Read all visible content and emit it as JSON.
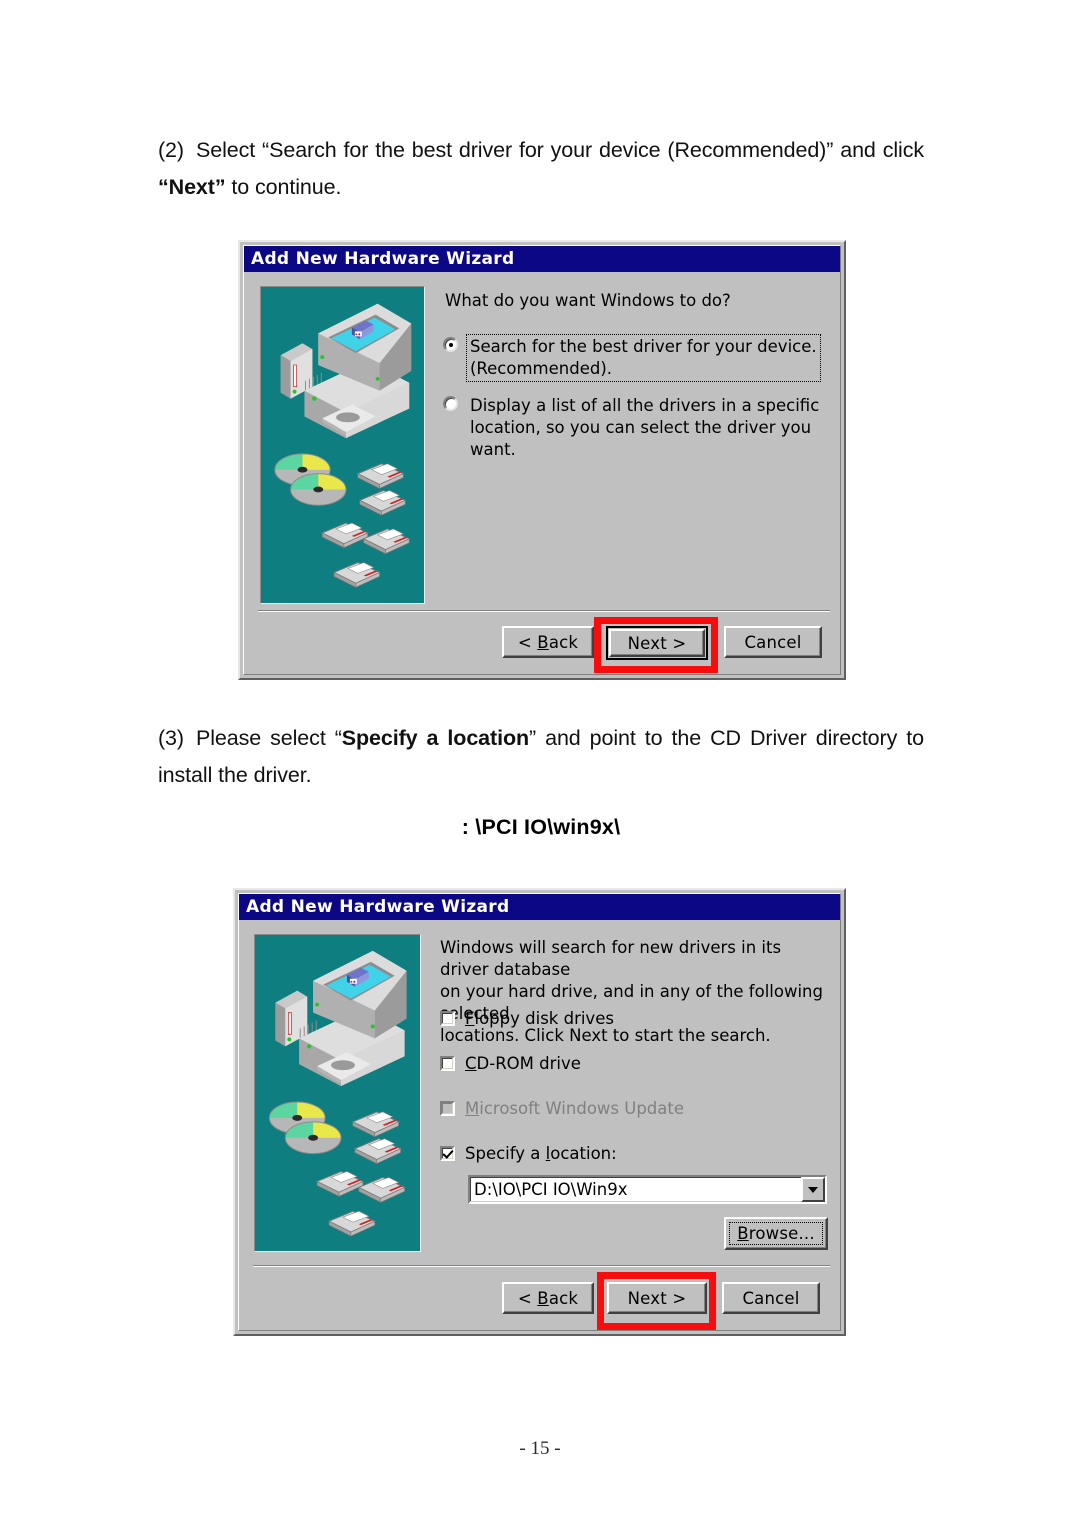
{
  "document": {
    "page_number": "- 15 -",
    "step2": {
      "number": "(2)",
      "text_before": "Select “Search for the best driver for your device (Recommended)” and click ",
      "bold": "“Next”",
      "text_after": " to continue."
    },
    "step3": {
      "number": "(3)",
      "text_before": "Please select “",
      "bold": "Specify a location",
      "text_after": "” and point to the CD Driver directory to install the driver."
    },
    "path_note": ": \\PCI IO\\win9x\\"
  },
  "dialog1": {
    "title": "Add New Hardware Wizard",
    "prompt": "What do you want Windows to do?",
    "options": [
      {
        "id": "search-best-driver",
        "line1": "Search for the best driver for your device.",
        "line2": "(Recommended).",
        "selected": true,
        "focused": true
      },
      {
        "id": "display-list-drivers",
        "line1": "Display a list of all the drivers in a specific",
        "line2": "location, so you can select the driver you want.",
        "selected": false,
        "focused": false
      }
    ],
    "buttons": {
      "back": "< Back",
      "back_mnemonic": "B",
      "next": "Next >",
      "cancel": "Cancel"
    },
    "highlight": {
      "target": "next",
      "color": "#f70d0d"
    }
  },
  "dialog2": {
    "title": "Add New Hardware Wizard",
    "prompt_lines": [
      "Windows will search for new drivers in its driver database",
      "on your hard drive, and in any of the following selected",
      "locations. Click Next to start the search."
    ],
    "checkboxes": [
      {
        "id": "floppy-disk-drives",
        "mnemonic": "F",
        "rest": "loppy disk drives",
        "checked": false,
        "disabled": false
      },
      {
        "id": "cd-rom-drive",
        "mnemonic": "C",
        "rest": "D-ROM drive",
        "checked": false,
        "disabled": false
      },
      {
        "id": "microsoft-windows-update",
        "mnemonic": "M",
        "rest": "icrosoft Windows Update",
        "checked": false,
        "disabled": true
      },
      {
        "id": "specify-a-location",
        "prefix": "Specify a ",
        "mnemonic": "l",
        "rest": "ocation:",
        "checked": true,
        "disabled": false
      }
    ],
    "location_combo": {
      "value": "D:\\IO\\PCI IO\\Win9x",
      "arrow_icon": "chevron-down-icon"
    },
    "browse_button": {
      "mnemonic": "B",
      "prefix": "B",
      "label": "Browse..."
    },
    "buttons": {
      "back": "< Back",
      "back_mnemonic": "B",
      "next": "Next >",
      "cancel": "Cancel"
    },
    "highlight": {
      "target": "next",
      "color": "#f70d0d"
    }
  },
  "illustration": {
    "name": "computer-with-cds-and-floppies-illustration",
    "background": "#0e7e80",
    "elements": [
      "monitor",
      "tower",
      "cd-tray",
      "compact-discs",
      "floppy-disks"
    ]
  },
  "theme": {
    "dialog_face": "#c0c0c0",
    "title_bar": "#0c0885",
    "title_text": "#ffffff",
    "teal_panel": "#0e7e80",
    "highlight_red": "#f70d0d"
  }
}
